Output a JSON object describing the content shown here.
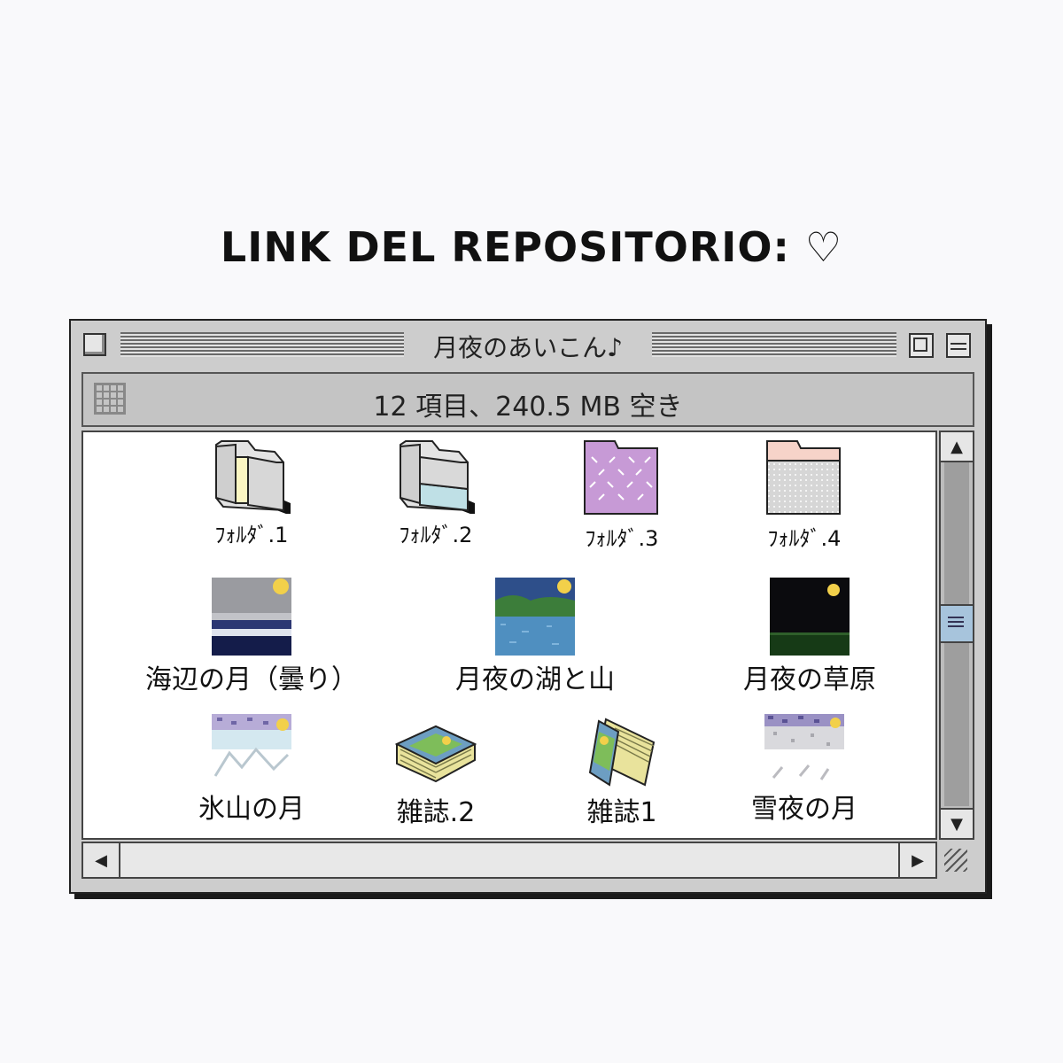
{
  "heading": "LINK DEL REPOSITORIO: ♡",
  "window": {
    "title": "月夜のあいこん♪",
    "info": "12 項目、240.5 MB 空き"
  },
  "items": [
    {
      "label": "ﾌｫﾙﾀﾞ.1",
      "icon": "folder-icon"
    },
    {
      "label": "ﾌｫﾙﾀﾞ.2",
      "icon": "folder-icon"
    },
    {
      "label": "ﾌｫﾙﾀﾞ.3",
      "icon": "folder-icon"
    },
    {
      "label": "ﾌｫﾙﾀﾞ.4",
      "icon": "folder-icon"
    },
    {
      "label": "海辺の月（曇り）",
      "icon": "picture-icon"
    },
    {
      "label": "月夜の湖と山",
      "icon": "picture-icon"
    },
    {
      "label": "月夜の草原",
      "icon": "picture-icon"
    },
    {
      "label": "氷山の月",
      "icon": "picture-icon"
    },
    {
      "label": "雑誌.2",
      "icon": "magazine-icon"
    },
    {
      "label": "雑誌1",
      "icon": "magazine-icon"
    },
    {
      "label": "雪夜の月",
      "icon": "picture-icon"
    }
  ],
  "colors": {
    "window_face": "#cdcdcd",
    "scroll_thumb": "#a7c4dc",
    "folder_purple": "#c79ad6",
    "folder_peach": "#f6d3c9",
    "moon": "#f2d04a"
  }
}
